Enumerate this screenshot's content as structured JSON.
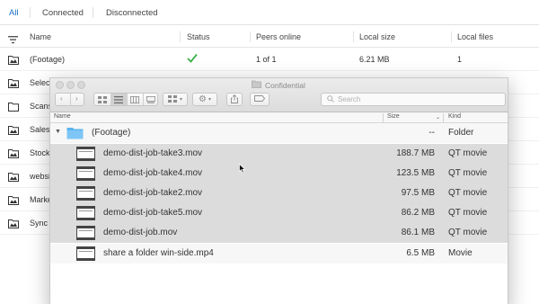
{
  "tabs": [
    {
      "label": "All",
      "active": true
    },
    {
      "label": "Connected",
      "active": false
    },
    {
      "label": "Disconnected",
      "active": false
    }
  ],
  "list": {
    "filter_icon": "filter-icon",
    "columns": {
      "name": "Name",
      "status": "Status",
      "peers": "Peers online",
      "size": "Local size",
      "files": "Local files"
    },
    "rows": [
      {
        "name": "(Footage)",
        "status_icon": "checkmark-icon",
        "peers": "1 of 1",
        "size": "6.21 MB",
        "files": "1"
      },
      {
        "name": "Selec"
      },
      {
        "name": "Scans"
      },
      {
        "name": "Sales"
      },
      {
        "name": "Stock"
      },
      {
        "name": "websi"
      },
      {
        "name": "Marke"
      },
      {
        "name": "Sync"
      }
    ]
  },
  "finder": {
    "title": "Confidential",
    "search_placeholder": "Search",
    "columns": {
      "name": "Name",
      "size": "Size",
      "kind": "Kind"
    },
    "folder": {
      "name": "(Footage)",
      "size": "--",
      "kind": "Folder"
    },
    "files": [
      {
        "name": "demo-dist-job-take3.mov",
        "size": "188.7 MB",
        "kind": "QT movie",
        "selected": true
      },
      {
        "name": "demo-dist-job-take4.mov",
        "size": "123.5 MB",
        "kind": "QT movie",
        "selected": true
      },
      {
        "name": "demo-dist-job-take2.mov",
        "size": "97.5 MB",
        "kind": "QT movie",
        "selected": true
      },
      {
        "name": "demo-dist-job-take5.mov",
        "size": "86.2 MB",
        "kind": "QT movie",
        "selected": true
      },
      {
        "name": "demo-dist-job.mov",
        "size": "86.1 MB",
        "kind": "QT movie",
        "selected": true
      },
      {
        "name": "share a folder win-side.mp4",
        "size": "6.5 MB",
        "kind": "Movie",
        "selected": false
      }
    ]
  },
  "colors": {
    "accent": "#1a73c8",
    "check": "#3cb34a",
    "folder": "#5ab4ef",
    "selection": "#dcdcdc"
  }
}
